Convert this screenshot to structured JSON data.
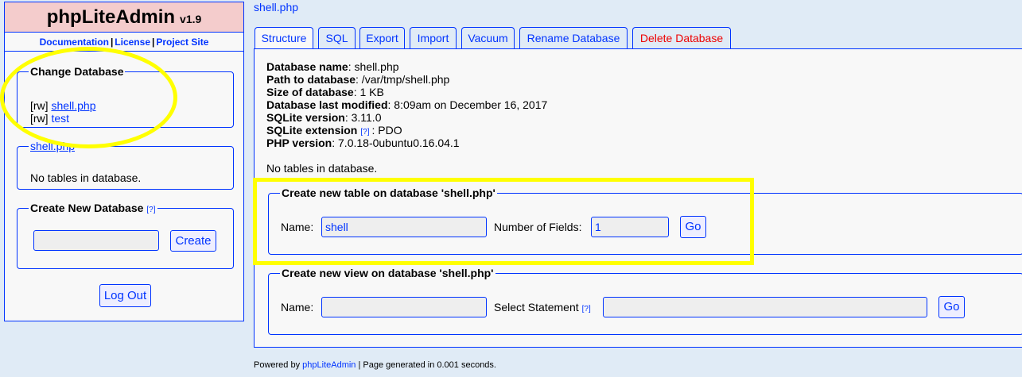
{
  "app": {
    "name": "phpLiteAdmin",
    "version": "v1.9"
  },
  "top_links": {
    "documentation": "Documentation",
    "license": "License",
    "project_site": "Project Site",
    "separator": "|"
  },
  "change_database": {
    "title": "Change Database",
    "items": [
      {
        "mode": "[rw]",
        "name": "shell.php"
      },
      {
        "mode": "[rw]",
        "name": "test"
      }
    ]
  },
  "current_db_box": {
    "legend": "shell.php",
    "message": "No tables in database."
  },
  "create_db": {
    "title": "Create New Database",
    "help": "[?]",
    "input_value": "",
    "button": "Create"
  },
  "logout": "Log Out",
  "breadcrumb": "shell.php",
  "tabs": [
    "Structure",
    "SQL",
    "Export",
    "Import",
    "Vacuum",
    "Rename Database",
    "Delete Database"
  ],
  "info": [
    {
      "label": "Database name",
      "value": ": shell.php"
    },
    {
      "label": "Path to database",
      "value": ": /var/tmp/shell.php"
    },
    {
      "label": "Size of database",
      "value": ": 1 KB"
    },
    {
      "label": "Database last modified",
      "value": ": 8:09am on December 16, 2017"
    },
    {
      "label": "SQLite version",
      "value": ": 3.11.0"
    },
    {
      "label": "SQLite extension",
      "help": "[?]",
      "value": ": PDO"
    },
    {
      "label": "PHP version",
      "value": ": 7.0.18-0ubuntu0.16.04.1"
    }
  ],
  "no_tables": "No tables in database.",
  "create_table": {
    "title": "Create new table on database 'shell.php'",
    "name_label": "Name:",
    "name_value": "shell",
    "fields_label": "Number of Fields:",
    "fields_value": "1",
    "button": "Go"
  },
  "create_view": {
    "title": "Create new view on database 'shell.php'",
    "name_label": "Name:",
    "name_value": "",
    "statement_label": "Select Statement",
    "help": "[?]",
    "statement_value": "",
    "button": "Go"
  },
  "footer": {
    "prefix": "Powered by ",
    "link": "phpLiteAdmin",
    "suffix": " | Page generated in 0.001 seconds."
  },
  "colors": {
    "accent": "#0033ff",
    "highlight": "#ffff00",
    "danger": "#ee0000",
    "logo_bg": "#f4cccc"
  }
}
